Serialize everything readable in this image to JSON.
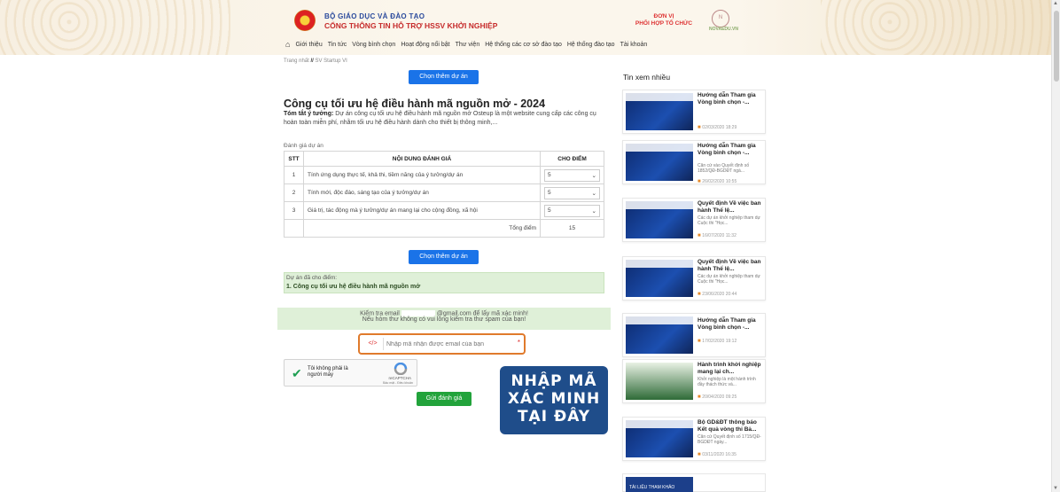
{
  "header": {
    "brand_line1": "BỘ GIÁO DỤC VÀ ĐÀO TẠO",
    "brand_line2": "CỔNG THÔNG TIN HỖ TRỢ HSSV KHỞI NGHIỆP",
    "org_line1": "ĐƠN VỊ",
    "org_line2": "PHỐI HỢP TỔ CHỨC",
    "org_logo_text": "NOVAEDU.VN",
    "nav": [
      "Giới thiệu",
      "Tin tức",
      "Vòng bình chọn",
      "Hoạt động nổi bật",
      "Thư viện",
      "Hệ thống các cơ sở đào tạo",
      "Hệ thống đào tạo",
      "Tài khoản"
    ]
  },
  "breadcrumb": {
    "home": "Trang nhất",
    "sep": "//",
    "current": "SV Startup VI"
  },
  "main": {
    "choose_more_button": "Chọn thêm dự án",
    "title": "Công cụ tối ưu hệ điều hành mã nguồn mở - 2024",
    "summary_label": "Tóm tắt ý tưởng:",
    "summary_text": "Dự án công cụ tối ưu hệ điều hành mã nguồn mở Osteup là một website cung cấp các công cụ hoàn toàn miễn phí, nhằm tối ưu hệ điều hành dành cho thiết bị thông minh,...",
    "eval_label": "Đánh giá dự án",
    "table": {
      "headers": [
        "STT",
        "NỘI DUNG ĐÁNH GIÁ",
        "CHO ĐIỂM"
      ],
      "rows": [
        {
          "stt": "1",
          "content": "Tính ứng dụng thực tế, khả thi, tiềm năng của ý tưởng/dự án",
          "score": "5"
        },
        {
          "stt": "2",
          "content": "Tính mới, độc đáo, sáng tạo của ý tưởng/dự án",
          "score": "5"
        },
        {
          "stt": "3",
          "content": "Giá trị, tác động mà ý tưởng/dự án mang lại cho cộng đồng, xã hội",
          "score": "5"
        }
      ],
      "total_label": "Tổng điểm",
      "total_value": "15"
    },
    "choose_button": "Chọn thêm dự án",
    "scored_label": "Dự án đã cho điểm:",
    "scored_item": "1. Công cụ tối ưu hệ điều hành mã nguồn mở",
    "email_line1_pre": "Kiểm tra email",
    "email_line1_post": "@gmail.com để lấy mã xác minh!",
    "email_line2": "Nếu hòm thư không có vui lòng kiểm tra thư spam của bạn!",
    "code_placeholder": "Nhập mã nhận được email của bạn",
    "code_required": "*",
    "captcha_label": "Tôi không phải là người máy",
    "captcha_brand": "reCAPTCHA",
    "captcha_terms": "Bảo mật - Điều khoản",
    "submit_button": "Gửi đánh giá",
    "callout_lines": [
      "NHẬP MÃ",
      "XÁC MINH",
      "TẠI ĐÂY"
    ]
  },
  "sidebar": {
    "title": "Tin xem nhiều",
    "cards": [
      {
        "title": "Hướng dẫn Tham gia Vòng bình chọn -...",
        "snippet": "",
        "date": "02/03/2020 18:29"
      },
      {
        "title": "Hướng dẫn Tham gia Vòng bình chọn -...",
        "snippet": "Căn cứ vào Quyết định số 1852/QĐ-BGDĐT ngà...",
        "date": "26/02/2020 10:55"
      },
      {
        "title": "Quyết định Về việc ban hành Thể lệ...",
        "snippet": "Các dự án khởi nghiệp tham dự Cuộc thi \"Học...",
        "date": "16/07/2020 11:32"
      },
      {
        "title": "Quyết định Về việc ban hành Thể lệ...",
        "snippet": "Các dự án khởi nghiệp tham dự Cuộc thi \"Học...",
        "date": "23/06/2020 20:44"
      },
      {
        "title": "Hướng dẫn Tham gia Vòng bình chọn -...",
        "snippet": "",
        "date": "17/02/2020 19:12"
      },
      {
        "title": "Hành trình khởi nghiệp mang lại ch...",
        "snippet": "Khởi nghiệp là một hành trình đầy thách thức và...",
        "date": "20/04/2020 09:25"
      },
      {
        "title": "Bộ GD&ĐT thông báo Kết quả vòng thi Bả...",
        "snippet": "Căn cứ Quyết định số 1715/QĐ-BGDĐT ngày...",
        "date": "03/11/2020 16:35"
      }
    ],
    "partial_card_text": "TÀI LIỆU THAM KHẢO"
  }
}
